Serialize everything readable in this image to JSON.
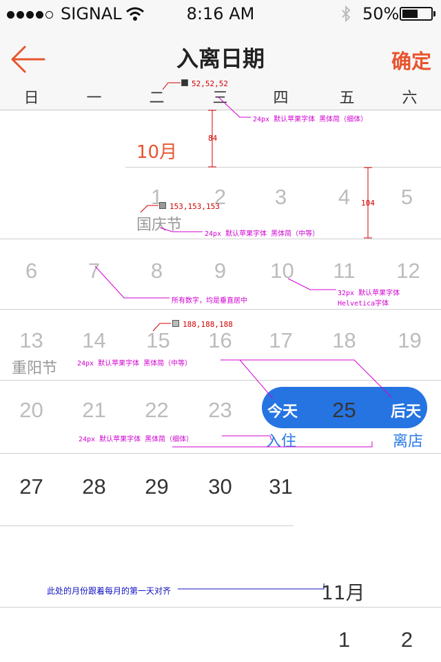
{
  "status": {
    "carrier": "SIGNAL",
    "time": "8:16 AM",
    "battery": "50%"
  },
  "nav": {
    "title": "入离日期",
    "confirm": "确定"
  },
  "weekdays": [
    "日",
    "一",
    "二",
    "三",
    "四",
    "五",
    "六"
  ],
  "october": {
    "month": "10月",
    "days": [
      "1",
      "2",
      "3",
      "4",
      "5",
      "6",
      "7",
      "8",
      "9",
      "10",
      "11",
      "12",
      "13",
      "14",
      "15",
      "16",
      "17",
      "18",
      "19",
      "20",
      "21",
      "22",
      "23",
      "25",
      "27",
      "28",
      "29",
      "30",
      "31"
    ],
    "holidays": {
      "d1": "国庆节",
      "d13": "重阳节"
    },
    "today_label": "今天",
    "after_label": "后天",
    "checkin_label": "入住",
    "checkout_label": "离店"
  },
  "november": {
    "month": "11月",
    "days": [
      "1",
      "2"
    ]
  },
  "annotations": {
    "a1": "52,52,52",
    "a2": "24px  默认苹果字体  黑体简（细体）",
    "a3": "84",
    "a4": "153,153,153",
    "a5": "104",
    "a6": "24px  默认苹果字体  黑体简（中等）",
    "a7": "所有数字，均是垂直居中",
    "a8": "32px  默认苹果字体",
    "a8b": "Helvetica字体",
    "a9": "188,188,188",
    "a10": "24px  默认苹果字体  黑体简（中等）",
    "a11": "24px  默认苹果字体  黑体简（细体）",
    "a12": "此处的月份跟着每月的第一天对齐"
  },
  "colors": {
    "accent": "#e8542e",
    "blue": "#2674e2",
    "dark": "#343434",
    "mid": "#999999",
    "light": "#bcbcbc"
  }
}
